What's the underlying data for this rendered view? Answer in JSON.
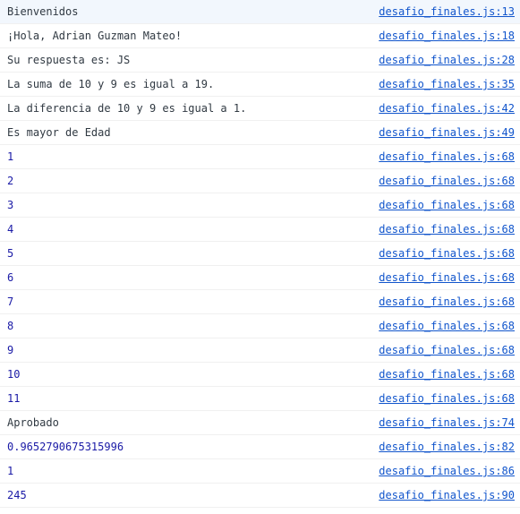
{
  "console": {
    "source_file": "desafio_finales.js",
    "rows": [
      {
        "message": "Bienvenidos",
        "type": "text",
        "line": 13
      },
      {
        "message": "¡Hola, Adrian Guzman Mateo!",
        "type": "text",
        "line": 18
      },
      {
        "message": "Su respuesta es: JS",
        "type": "text",
        "line": 28
      },
      {
        "message": "La suma de 10 y 9 es igual a 19.",
        "type": "text",
        "line": 35
      },
      {
        "message": "La diferencia de 10 y 9 es igual a 1.",
        "type": "text",
        "line": 42
      },
      {
        "message": "Es mayor de Edad",
        "type": "text",
        "line": 49
      },
      {
        "message": "1",
        "type": "number",
        "line": 68
      },
      {
        "message": "2",
        "type": "number",
        "line": 68
      },
      {
        "message": "3",
        "type": "number",
        "line": 68
      },
      {
        "message": "4",
        "type": "number",
        "line": 68
      },
      {
        "message": "5",
        "type": "number",
        "line": 68
      },
      {
        "message": "6",
        "type": "number",
        "line": 68
      },
      {
        "message": "7",
        "type": "number",
        "line": 68
      },
      {
        "message": "8",
        "type": "number",
        "line": 68
      },
      {
        "message": "9",
        "type": "number",
        "line": 68
      },
      {
        "message": "10",
        "type": "number",
        "line": 68
      },
      {
        "message": "11",
        "type": "number",
        "line": 68
      },
      {
        "message": "Aprobado",
        "type": "text",
        "line": 74
      },
      {
        "message": "0.9652790675315996",
        "type": "number",
        "line": 82
      },
      {
        "message": "1",
        "type": "number",
        "line": 86
      },
      {
        "message": "245",
        "type": "number",
        "line": 90
      }
    ]
  }
}
